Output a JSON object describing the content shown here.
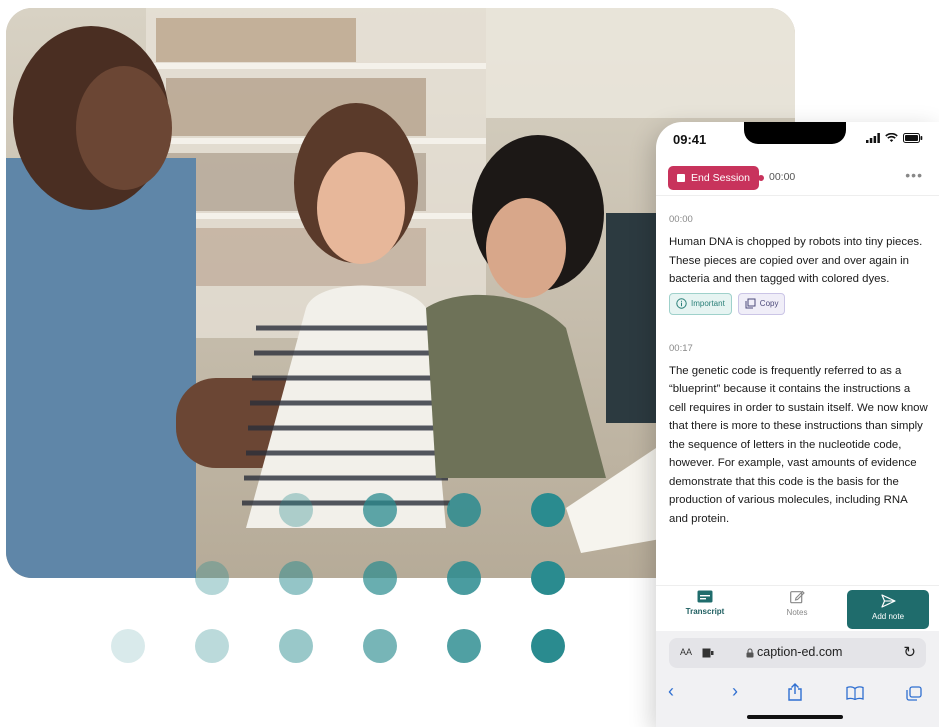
{
  "colors": {
    "accent_teal": "#1f6c6c",
    "end_button": "#c8335c",
    "dot_teal": "#2a8b8f"
  },
  "phone": {
    "status_time": "09:41",
    "end_session_label": "End Session",
    "timer": "00:00",
    "more_icon": "more-horizontal-icon",
    "segments": [
      {
        "timestamp": "00:00",
        "text": "Human DNA is chopped by robots into tiny pieces. These pieces are copied over and over again in bacteria and then tagged with colored dyes.",
        "important_label": "Important",
        "copy_label": "Copy"
      },
      {
        "timestamp": "00:17",
        "text": "The genetic code is frequently referred to as a “blueprint” because it contains the instructions a cell requires in order to sustain itself. We now know that there is more to these instructions than simply the sequence of letters in the nucleotide code, however. For example, vast amounts of evidence demonstrate that this code is the basis for the production of various molecules, including RNA and protein."
      }
    ],
    "nav": {
      "transcript_label": "Transcript",
      "notes_label": "Notes",
      "add_note_label": "Add note"
    },
    "browser": {
      "text_size_label": "AA",
      "url": "caption-ed.com"
    }
  }
}
